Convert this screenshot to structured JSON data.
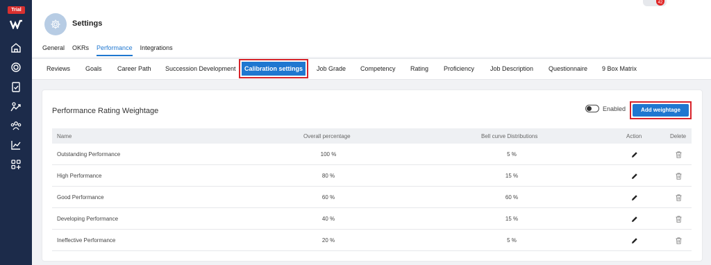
{
  "sidebar": {
    "badge": "Trial",
    "icons": [
      "home-icon",
      "target-icon",
      "clipboard-icon",
      "growth-icon",
      "team-icon",
      "chart-icon",
      "apps-add-icon"
    ]
  },
  "header": {
    "notification_count": "42",
    "title": "Settings",
    "tabs": [
      "General",
      "OKRs",
      "Performance",
      "Integrations"
    ],
    "active_tab": "Performance"
  },
  "subtabs": {
    "items": [
      "Reviews",
      "Goals",
      "Career Path",
      "Succession Development",
      "Calibration settings",
      "Job Grade",
      "Competency",
      "Rating",
      "Proficiency",
      "Job Description",
      "Questionnaire",
      "9 Box Matrix"
    ],
    "active": "Calibration settings"
  },
  "card": {
    "title": "Performance Rating Weightage",
    "toggle_label": "Enabled",
    "add_button": "Add weightage"
  },
  "table": {
    "headers": [
      "Name",
      "Overall percentage",
      "Bell curve Distributions",
      "Action",
      "Delete"
    ],
    "rows": [
      {
        "name": "Outstanding Performance",
        "overall": "100 %",
        "bell": "5 %"
      },
      {
        "name": "High Performance",
        "overall": "80 %",
        "bell": "15 %"
      },
      {
        "name": "Good Performance",
        "overall": "60 %",
        "bell": "60 %"
      },
      {
        "name": "Developing Performance",
        "overall": "40 %",
        "bell": "15 %"
      },
      {
        "name": "Ineffective Performance",
        "overall": "20 %",
        "bell": "5 %"
      }
    ]
  },
  "colors": {
    "sidebar": "#1c2b4a",
    "accent": "#1f77d0",
    "highlight": "#d8232a"
  }
}
